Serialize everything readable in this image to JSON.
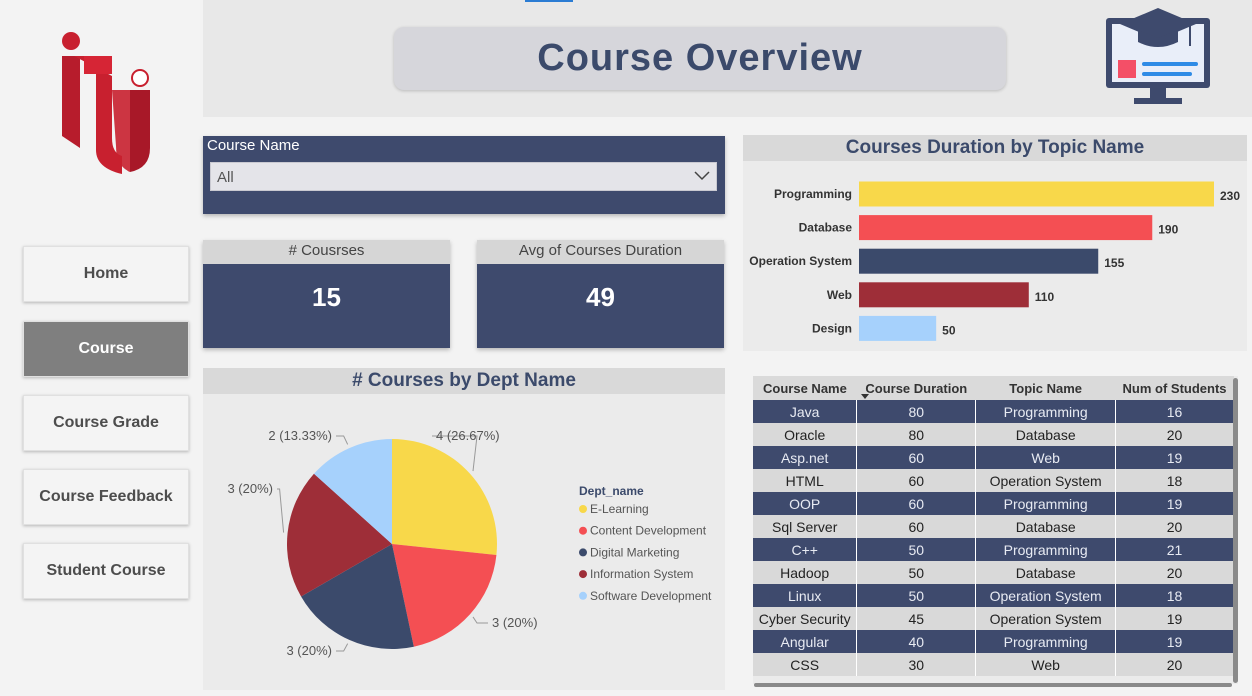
{
  "header": {
    "title": "Course Overview"
  },
  "nav": {
    "items": [
      {
        "label": "Home",
        "active": false
      },
      {
        "label": "Course",
        "active": true
      },
      {
        "label": "Course Grade",
        "active": false
      },
      {
        "label": "Course Feedback",
        "active": false
      },
      {
        "label": "Student Course",
        "active": false
      }
    ]
  },
  "slicer": {
    "label": "Course Name",
    "value": "All"
  },
  "cards": [
    {
      "label": "# Cousrses",
      "value": "15"
    },
    {
      "label": "Avg of Courses Duration",
      "value": "49"
    }
  ],
  "pie_chart": {
    "title": "# Courses by Dept Name",
    "legend_title": "Dept_name"
  },
  "bar_chart": {
    "title": "Courses Duration by Topic Name"
  },
  "chart_data": [
    {
      "type": "pie",
      "title": "# Courses by Dept Name",
      "legend_title": "Dept_name",
      "categories": [
        "E-Learning",
        "Content Development",
        "Digital Marketing",
        "Information System",
        "Software Development"
      ],
      "values": [
        4,
        3,
        3,
        3,
        2
      ],
      "labels": [
        "4 (26.67%)",
        "3 (20%)",
        "3 (20%)",
        "3 (20%)",
        "2 (13.33%)"
      ],
      "colors": [
        "#f8d84a",
        "#f44f53",
        "#3b4a6b",
        "#9e2e38",
        "#a6d1fc"
      ]
    },
    {
      "type": "bar",
      "orientation": "horizontal",
      "title": "Courses Duration by Topic Name",
      "categories": [
        "Programming",
        "Database",
        "Operation System",
        "Web",
        "Design"
      ],
      "values": [
        230,
        190,
        155,
        110,
        50
      ],
      "colors": [
        "#f8d84a",
        "#f44f53",
        "#3b4a6b",
        "#9e2e38",
        "#a6d1fc"
      ]
    }
  ],
  "table": {
    "columns": [
      "Course Name",
      "Course Duration",
      "Topic Name",
      "Num of Students"
    ],
    "rows": [
      [
        "Java",
        "80",
        "Programming",
        "16"
      ],
      [
        "Oracle",
        "80",
        "Database",
        "20"
      ],
      [
        "Asp.net",
        "60",
        "Web",
        "19"
      ],
      [
        "HTML",
        "60",
        "Operation System",
        "18"
      ],
      [
        "OOP",
        "60",
        "Programming",
        "19"
      ],
      [
        "Sql Server",
        "60",
        "Database",
        "20"
      ],
      [
        "C++",
        "50",
        "Programming",
        "21"
      ],
      [
        "Hadoop",
        "50",
        "Database",
        "20"
      ],
      [
        "Linux",
        "50",
        "Operation System",
        "18"
      ],
      [
        "Cyber Security",
        "45",
        "Operation System",
        "19"
      ],
      [
        "Angular",
        "40",
        "Programming",
        "19"
      ],
      [
        "CSS",
        "30",
        "Web",
        "20"
      ]
    ]
  }
}
